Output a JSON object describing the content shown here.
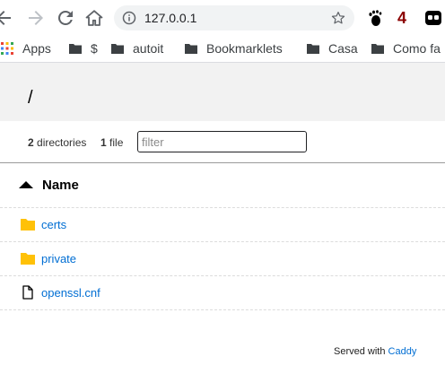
{
  "browser": {
    "url": "127.0.0.1",
    "extension_badge": "4"
  },
  "bookmarks": [
    {
      "label": "Apps",
      "icon": "apps-grid-icon"
    },
    {
      "label": "$",
      "icon": "folder-icon"
    },
    {
      "label": "autoit",
      "icon": "folder-icon"
    },
    {
      "label": "Bookmarklets",
      "icon": "folder-icon"
    },
    {
      "label": "Casa",
      "icon": "folder-icon"
    },
    {
      "label": "Como fa",
      "icon": "folder-icon"
    }
  ],
  "listing": {
    "path": "/",
    "directories_count": "2",
    "directories_label": "directories",
    "files_count": "1",
    "files_label": "file",
    "filter_placeholder": "filter",
    "column_name": "Name",
    "entries": [
      {
        "name": "certs",
        "type": "folder"
      },
      {
        "name": "private",
        "type": "folder"
      },
      {
        "name": "openssl.cnf",
        "type": "file"
      }
    ]
  },
  "footer": {
    "prefix": "Served with",
    "link": "Caddy"
  },
  "colors": {
    "link": "#006ed3",
    "folder": "#ffc107",
    "header_bg": "#f2f2f2"
  }
}
